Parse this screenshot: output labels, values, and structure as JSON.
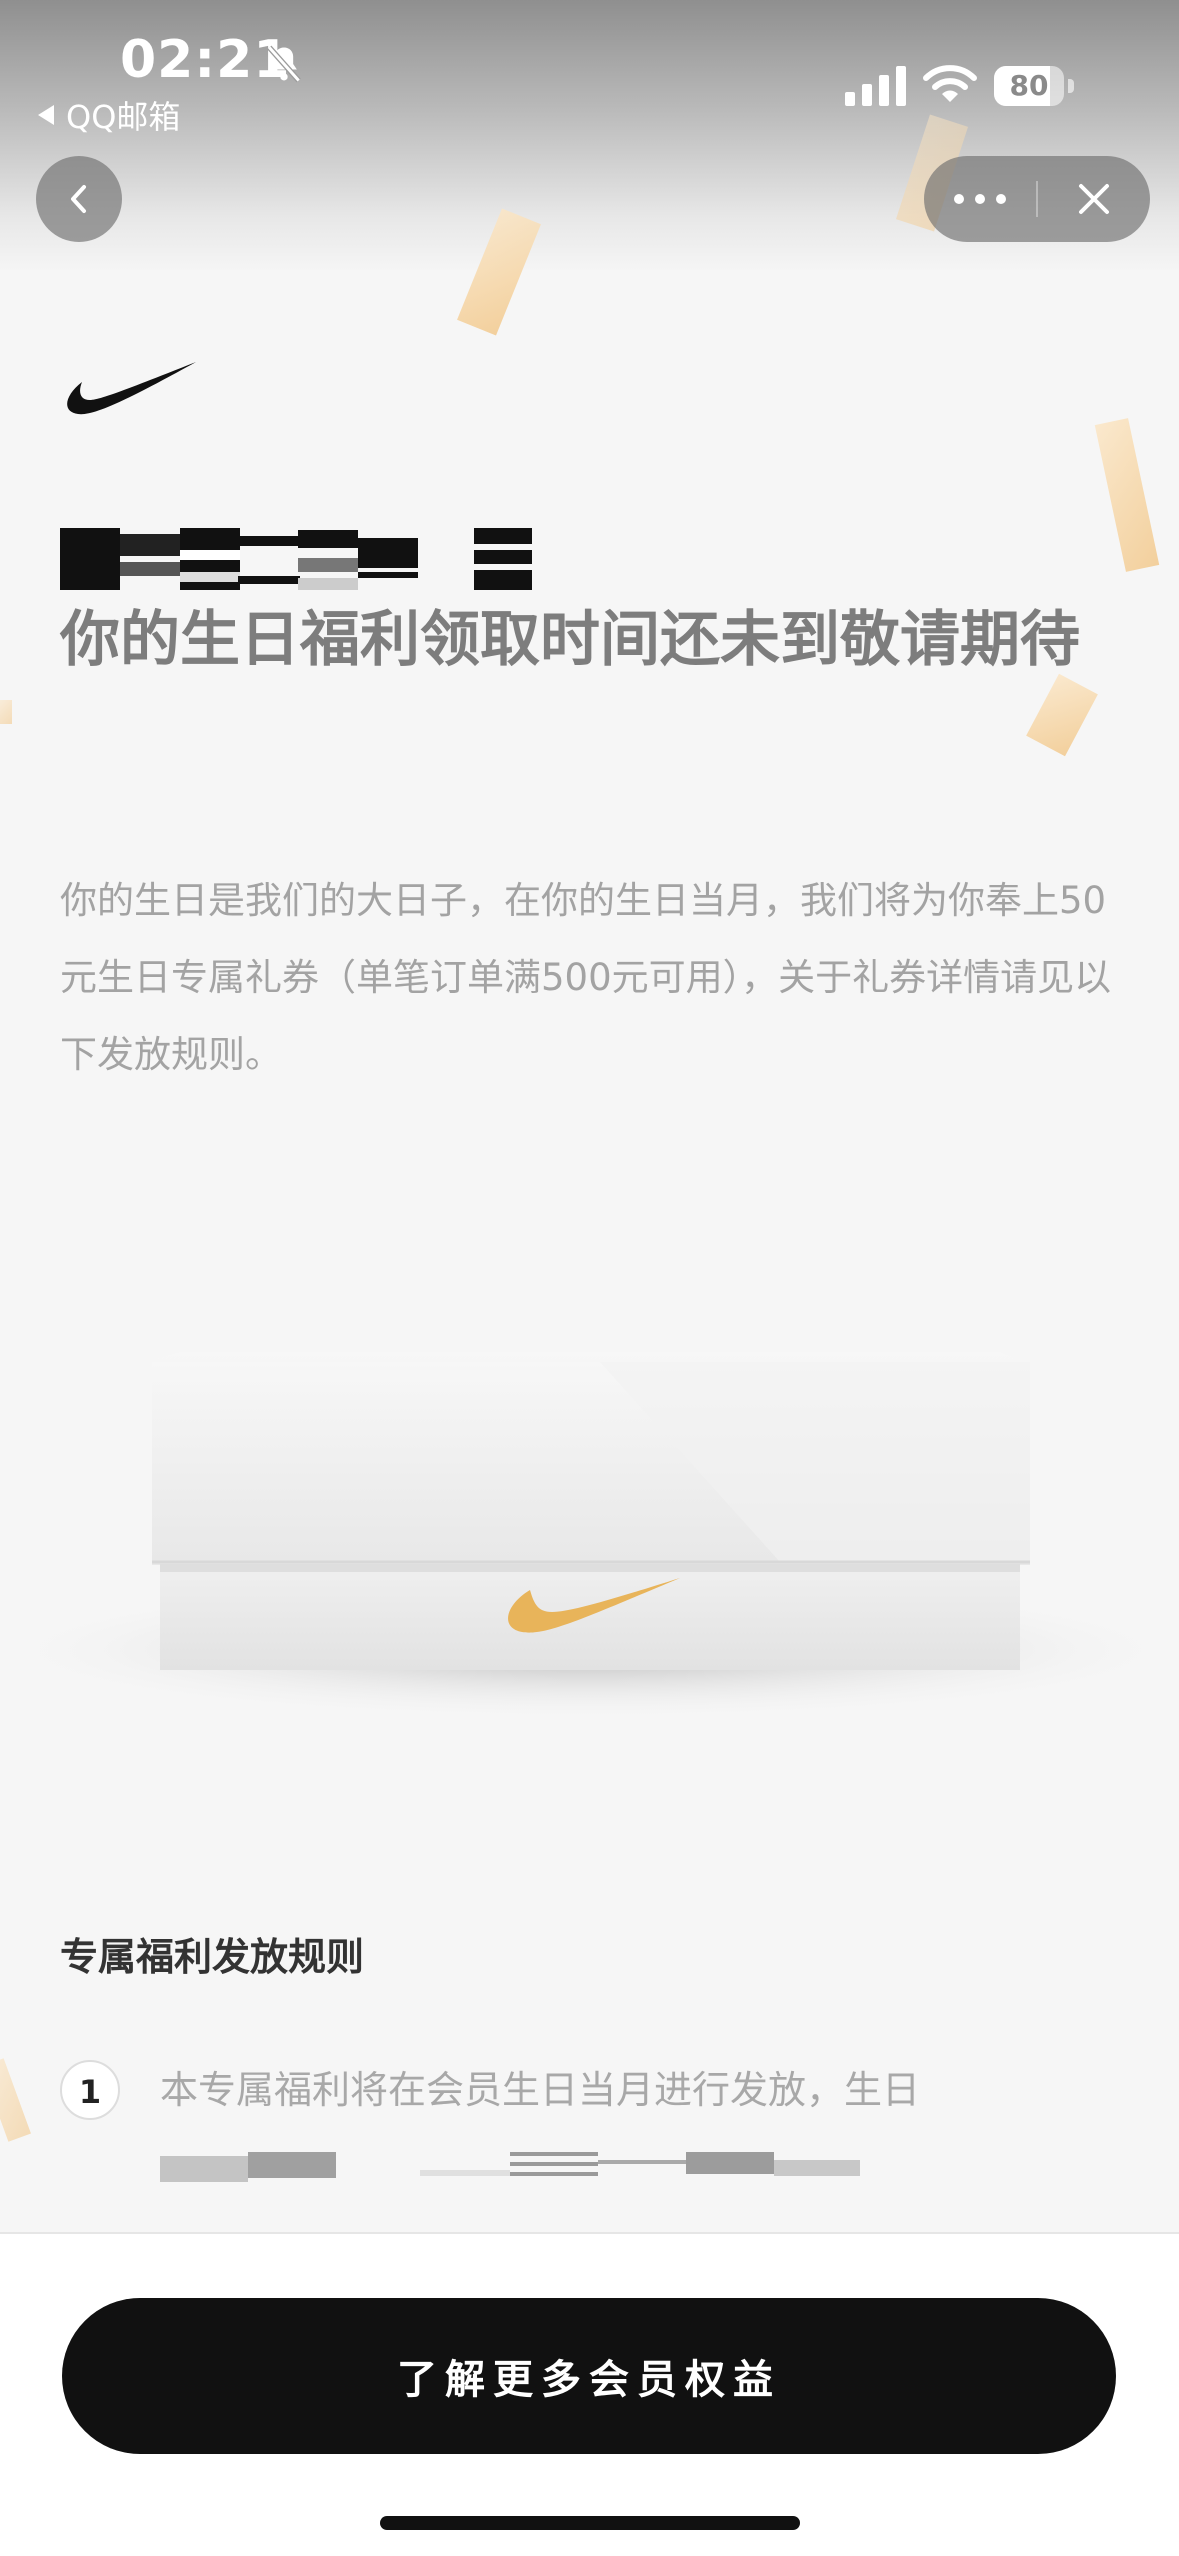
{
  "status_bar": {
    "time": "02:21",
    "back_app_label": "QQ邮箱",
    "battery_level": "80",
    "battery_fraction": 0.8,
    "icons": [
      "bell-off-icon",
      "signal-icon",
      "wifi-icon",
      "battery-icon"
    ]
  },
  "nav": {
    "back_icon": "chevron-left-icon",
    "more_icon": "more-dots-icon",
    "close_icon": "close-icon"
  },
  "brand": {
    "logo": "nike-swoosh-logo"
  },
  "headline": "你的生日福利领取时间还未到敬请期待",
  "intro": "你的生日是我们的大日子，在你的生日当月，我们将为你奉上50元生日专属礼券（单笔订单满500元可用），关于礼券详情请见以下发放规则。",
  "rules": {
    "title": "专属福利发放规则",
    "items": [
      {
        "number": "1",
        "text": "本专属福利将在会员生日当月进行发放，生日"
      }
    ]
  },
  "cta": {
    "label": "了解更多会员权益"
  },
  "colors": {
    "accent_gold": "#e8b45a",
    "button_bg": "#111111",
    "headline": "#7d7d7d"
  }
}
